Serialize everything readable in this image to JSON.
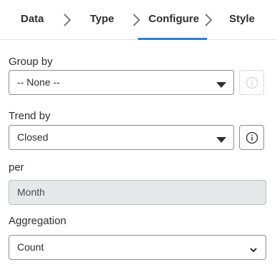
{
  "tabs": [
    {
      "label": "Data"
    },
    {
      "label": "Type"
    },
    {
      "label": "Configure"
    },
    {
      "label": "Style"
    }
  ],
  "active_tab": "Configure",
  "colors": {
    "accent": "#2e7fd1",
    "border": "#8d8d8d",
    "readonly_bg": "#e6e8ea"
  },
  "form": {
    "group_by": {
      "label": "Group by",
      "value": "-- None --",
      "info_icon": "info-circle-icon",
      "info_disabled": true
    },
    "trend_by": {
      "label": "Trend by",
      "value": "Closed",
      "info_icon": "info-circle-icon",
      "info_disabled": false
    },
    "per": {
      "label": "per",
      "value": "Month"
    },
    "aggregation": {
      "label": "Aggregation",
      "value": "Count"
    }
  }
}
